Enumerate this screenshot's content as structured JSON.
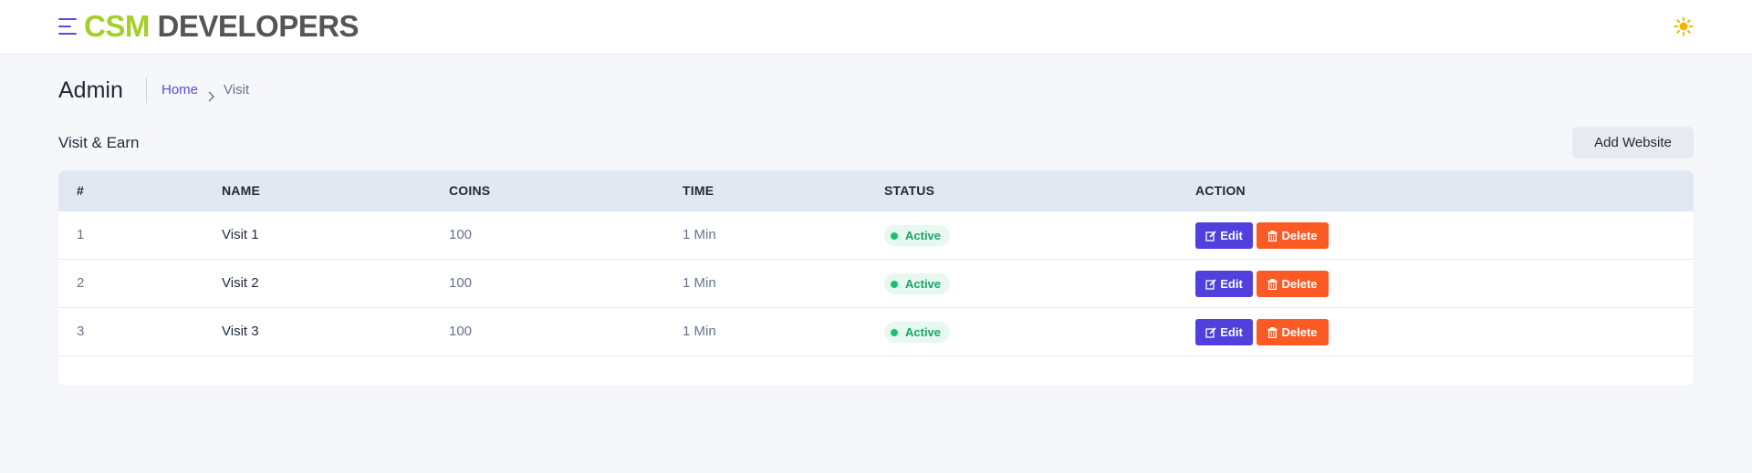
{
  "brand": {
    "part1": "CSM",
    "part2": "DEVELOPERS"
  },
  "header": {
    "menu_icon": "hamburger-menu-icon",
    "theme_icon": "sun-icon"
  },
  "page": {
    "title": "Admin",
    "breadcrumb": {
      "home": "Home",
      "current": "Visit"
    }
  },
  "section": {
    "title": "Visit & Earn",
    "add_button": "Add Website"
  },
  "table": {
    "columns": [
      "#",
      "NAME",
      "COINS",
      "TIME",
      "STATUS",
      "ACTION"
    ],
    "rows": [
      {
        "num": "1",
        "name": "Visit 1",
        "coins": "100",
        "time": "1 Min",
        "status": "Active",
        "edit": "Edit",
        "delete": "Delete"
      },
      {
        "num": "2",
        "name": "Visit 2",
        "coins": "100",
        "time": "1 Min",
        "status": "Active",
        "edit": "Edit",
        "delete": "Delete"
      },
      {
        "num": "3",
        "name": "Visit 3",
        "coins": "100",
        "time": "1 Min",
        "status": "Active",
        "edit": "Edit",
        "delete": "Delete"
      }
    ]
  },
  "colors": {
    "brand_green": "#a3cf28",
    "brand_gray": "#555555",
    "accent": "#5240dd",
    "danger": "#fb5a25",
    "success": "#1aa36a",
    "theme_icon": "#f5b400"
  }
}
